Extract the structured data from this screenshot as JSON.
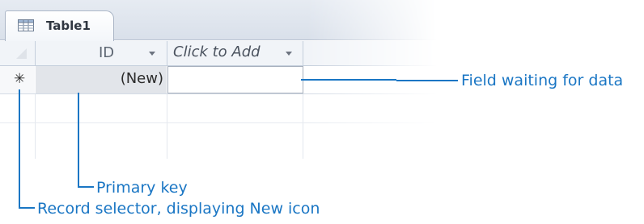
{
  "window": {
    "tab_title": "Table1",
    "tab_icon": "table-icon"
  },
  "datasheet": {
    "columns": [
      {
        "label": "ID",
        "has_dropdown": true
      },
      {
        "label": "Click to Add",
        "has_dropdown": true
      }
    ],
    "new_row": {
      "record_selector_icon": "new-record-asterisk-icon",
      "record_selector_glyph": "✳",
      "id_value": "(New)",
      "add_value": ""
    }
  },
  "callouts": {
    "field_waiting": "Field waiting for data",
    "primary_key": "Primary key",
    "record_selector": "Record selector, displaying New icon"
  },
  "colors": {
    "callout": "#1a76c4",
    "tab_background": "#dde3ec",
    "id_cell": "#e2e5ea"
  }
}
